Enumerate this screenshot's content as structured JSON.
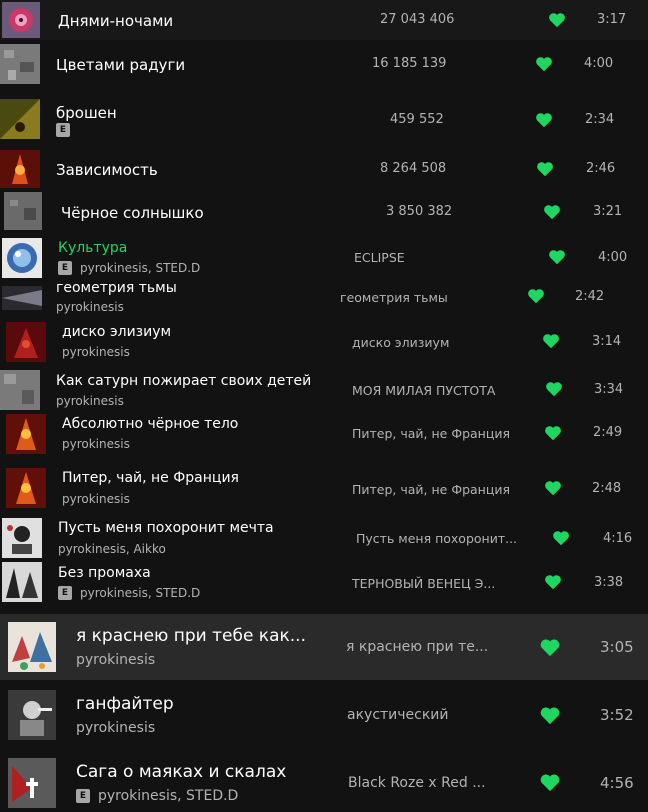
{
  "colors": {
    "accent": "#1ed760",
    "background": "#121212",
    "selected_row": "#2a2a2a",
    "secondary_text": "#b3b3b3"
  },
  "tracks": [
    {
      "title": "Днями-ночами",
      "plays": "27 043 406",
      "duration": "3:17",
      "liked": true
    },
    {
      "title": "Цветами радуги",
      "plays": "16 185 139",
      "duration": "4:00",
      "liked": true
    },
    {
      "title": "брошен",
      "explicit": "E",
      "plays": "459 552",
      "duration": "2:34",
      "liked": true
    },
    {
      "title": "Зависимость",
      "plays": "8 264 508",
      "duration": "2:46",
      "liked": true
    },
    {
      "title": "Чёрное солнышко",
      "plays": "3 850 382",
      "duration": "3:21",
      "liked": true
    },
    {
      "title": "Культура",
      "explicit": "E",
      "artists": "pyrokinesis, STED.D",
      "album": "ECLIPSE",
      "duration": "4:00",
      "liked": true,
      "playing": true
    },
    {
      "title": "геометрия тьмы",
      "artists": "pyrokinesis",
      "album": "геометрия тьмы",
      "duration": "2:42",
      "liked": true
    },
    {
      "title": "диско элизиум",
      "artists": "pyrokinesis",
      "album": "диско элизиум",
      "duration": "3:14",
      "liked": true
    },
    {
      "title": "Как сатурн пожирает своих детей",
      "artists": "pyrokinesis",
      "album": "МОЯ МИЛАЯ ПУСТОТА",
      "duration": "3:34",
      "liked": true
    },
    {
      "title": "Абсолютно чёрное тело",
      "artists": "pyrokinesis",
      "album": "Питер, чай, не Франция",
      "duration": "2:49",
      "liked": true
    },
    {
      "title": "Питер, чай, не Франция",
      "artists": "pyrokinesis",
      "album": "Питер, чай, не Франция",
      "duration": "2:48",
      "liked": true
    },
    {
      "title": "Пусть меня похоронит мечта",
      "artists": "pyrokinesis, Aikko",
      "album": "Пусть меня похоронит...",
      "duration": "4:16",
      "liked": true
    },
    {
      "title": "Без промаха",
      "explicit": "E",
      "artists": "pyrokinesis, STED.D",
      "album": "ТЕРНОВЫЙ ВЕНЕЦ Э...",
      "duration": "3:38",
      "liked": true
    },
    {
      "title": "я краснею при тебе как...",
      "artists": "pyrokinesis",
      "album": "я краснею при те...",
      "duration": "3:05",
      "liked": true,
      "selected": true
    },
    {
      "title": "ганфайтер",
      "artists": "pyrokinesis",
      "album": "акустический",
      "duration": "3:52",
      "liked": true
    },
    {
      "title": "Сага о маяках и скалах",
      "explicit": "E",
      "artists": "pyrokinesis, STED.D",
      "album": "Black Roze x Red ...",
      "duration": "4:56",
      "liked": true
    }
  ]
}
